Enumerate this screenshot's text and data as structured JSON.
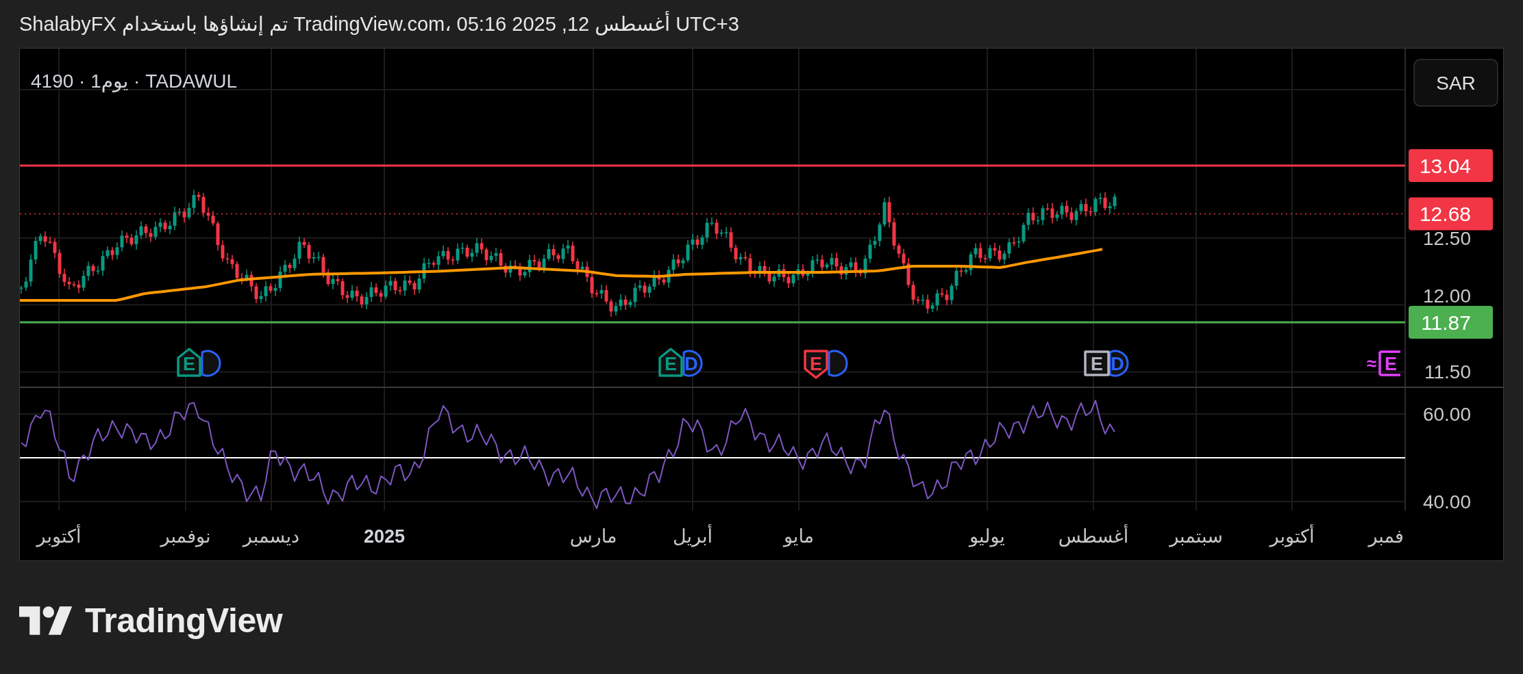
{
  "header": {
    "attribution": "ShalabyFX تم إنشاؤها باستخدام TradingView.com، أغسطس 12, 2025 05:16 UTC+3"
  },
  "chart": {
    "symbol": "4190 · 1يوم · TADAWUL",
    "currency_button": "SAR",
    "price_axis": [
      "12.50",
      "12.00",
      "11.50"
    ],
    "price_lines": [
      {
        "label": "13.04",
        "color": "#f23645",
        "kind": "solid"
      },
      {
        "label": "12.68",
        "color": "#f23645",
        "kind": "dotted"
      },
      {
        "label": "11.87",
        "color": "#4caf50",
        "kind": "solid"
      }
    ],
    "events": [
      {
        "kind": "bracket",
        "color": "#e040fb",
        "label": "E",
        "prefix": "≈",
        "dividend": false
      },
      {
        "kind": "square",
        "color": "#b2b5be",
        "label": "E",
        "dividend": true,
        "dividend_label": "D"
      },
      {
        "kind": "shield",
        "color": "#f23645",
        "label": "E",
        "dividend": true
      },
      {
        "kind": "house",
        "color": "#089981",
        "label": "E",
        "dividend": true,
        "dividend_label": "D"
      },
      {
        "kind": "house",
        "color": "#089981",
        "label": "E",
        "dividend": true
      }
    ],
    "rsi_axis": [
      "60.00",
      "40.00"
    ],
    "time_axis": [
      {
        "label": "فمبر",
        "bold": false
      },
      {
        "label": "أكتوبر",
        "bold": false
      },
      {
        "label": "سبتمبر",
        "bold": false
      },
      {
        "label": "أغسطس",
        "bold": false
      },
      {
        "label": "يوليو",
        "bold": false
      },
      {
        "label": "مايو",
        "bold": false
      },
      {
        "label": "أبريل",
        "bold": false
      },
      {
        "label": "مارس",
        "bold": false
      },
      {
        "label": "2025",
        "bold": true
      },
      {
        "label": "ديسمبر",
        "bold": false
      },
      {
        "label": "نوفمبر",
        "bold": false
      },
      {
        "label": "أكتوبر",
        "bold": false
      }
    ]
  },
  "logo": {
    "text": "TradingView"
  }
}
